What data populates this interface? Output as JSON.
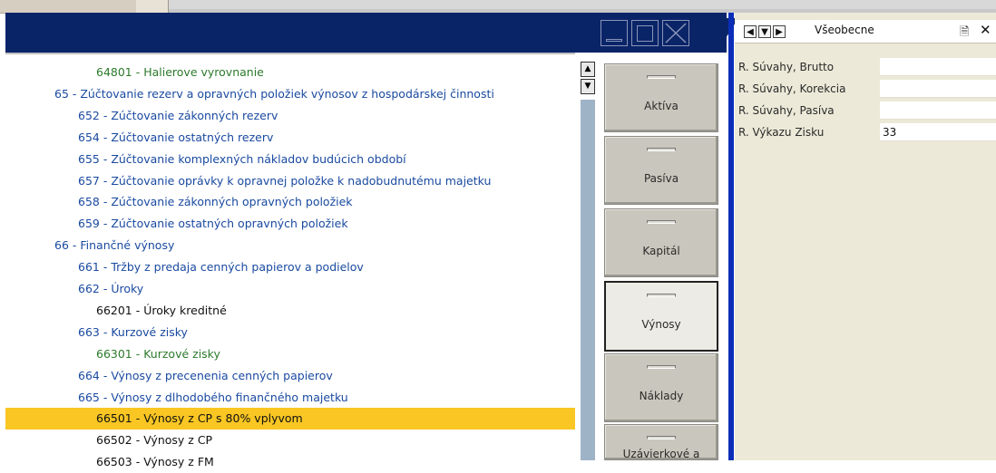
{
  "list": {
    "rows": [
      {
        "text": "64801 - Halierove vyrovnanie",
        "color": "green",
        "indent": 1
      },
      {
        "text": "65 - Zúčtovanie rezerv a opravných položiek výnosov z hospodárskej činnosti",
        "color": "blue",
        "indent": 0
      },
      {
        "text": "652 - Zúčtovanie zákonných rezerv",
        "color": "blue",
        "indent": 2
      },
      {
        "text": "654 - Zúčtovanie ostatných rezerv",
        "color": "blue",
        "indent": 2
      },
      {
        "text": "655 - Zúčtovanie komplexných nákladov budúcich období",
        "color": "blue",
        "indent": 2
      },
      {
        "text": "657 - Zúčtovanie oprávky k opravnej položke k nadobudnutému majetku",
        "color": "blue",
        "indent": 2
      },
      {
        "text": "658 - Zúčtovanie zákonných opravných položiek",
        "color": "blue",
        "indent": 2
      },
      {
        "text": "659 - Zúčtovanie ostatných opravných položiek",
        "color": "blue",
        "indent": 2
      },
      {
        "text": "66 - Finančné výnosy",
        "color": "blue",
        "indent": 0
      },
      {
        "text": "661 - Tržby z predaja cenných papierov a podielov",
        "color": "blue",
        "indent": 2
      },
      {
        "text": "662 - Úroky",
        "color": "blue",
        "indent": 2
      },
      {
        "text": "66201 - Úroky kreditné",
        "color": "black",
        "indent": 1
      },
      {
        "text": "663 - Kurzové zisky",
        "color": "blue",
        "indent": 2
      },
      {
        "text": "66301 - Kurzové zisky",
        "color": "green",
        "indent": 1
      },
      {
        "text": "664 - Výnosy z precenenia cenných papierov",
        "color": "blue",
        "indent": 2
      },
      {
        "text": "665 - Výnosy z dlhodobého finančného majetku",
        "color": "blue",
        "indent": 2
      },
      {
        "text": "66501 - Výnosy z CP s 80% vplyvom",
        "color": "black",
        "indent": 1,
        "selected": true
      },
      {
        "text": "66502 - Výnosy z CP",
        "color": "black",
        "indent": 1
      },
      {
        "text": "66503 - Výnosy z FM",
        "color": "black",
        "indent": 1
      }
    ]
  },
  "scroll": {
    "up_glyph": "▲",
    "down_glyph": "▼"
  },
  "tabs": [
    {
      "label": "Aktíva"
    },
    {
      "label": "Pasíva"
    },
    {
      "label": "Kapitál"
    },
    {
      "label": "Výnosy",
      "active": true
    },
    {
      "label": "Náklady"
    },
    {
      "label": "Uzávierkové a"
    }
  ],
  "panel": {
    "nav_prev": "◀",
    "nav_dropdown": "▼",
    "nav_next": "▶",
    "title": "Všeobecne",
    "doc_icon": "document-icon",
    "doc_glyph": "🗎",
    "close_glyph": "✕",
    "fields": [
      {
        "label": "R. Súvahy, Brutto",
        "value": ""
      },
      {
        "label": "R. Súvahy, Korekcia",
        "value": ""
      },
      {
        "label": "R. Súvahy, Pasíva",
        "value": ""
      },
      {
        "label": "R. Výkazu Zisku",
        "value": "33"
      }
    ]
  },
  "colors": {
    "title_bar": "#0a2468",
    "selection": "#f9c623",
    "blue_text": "#1a4aa0",
    "green_text": "#2c7a2c",
    "separator": "#0a2eb8"
  }
}
